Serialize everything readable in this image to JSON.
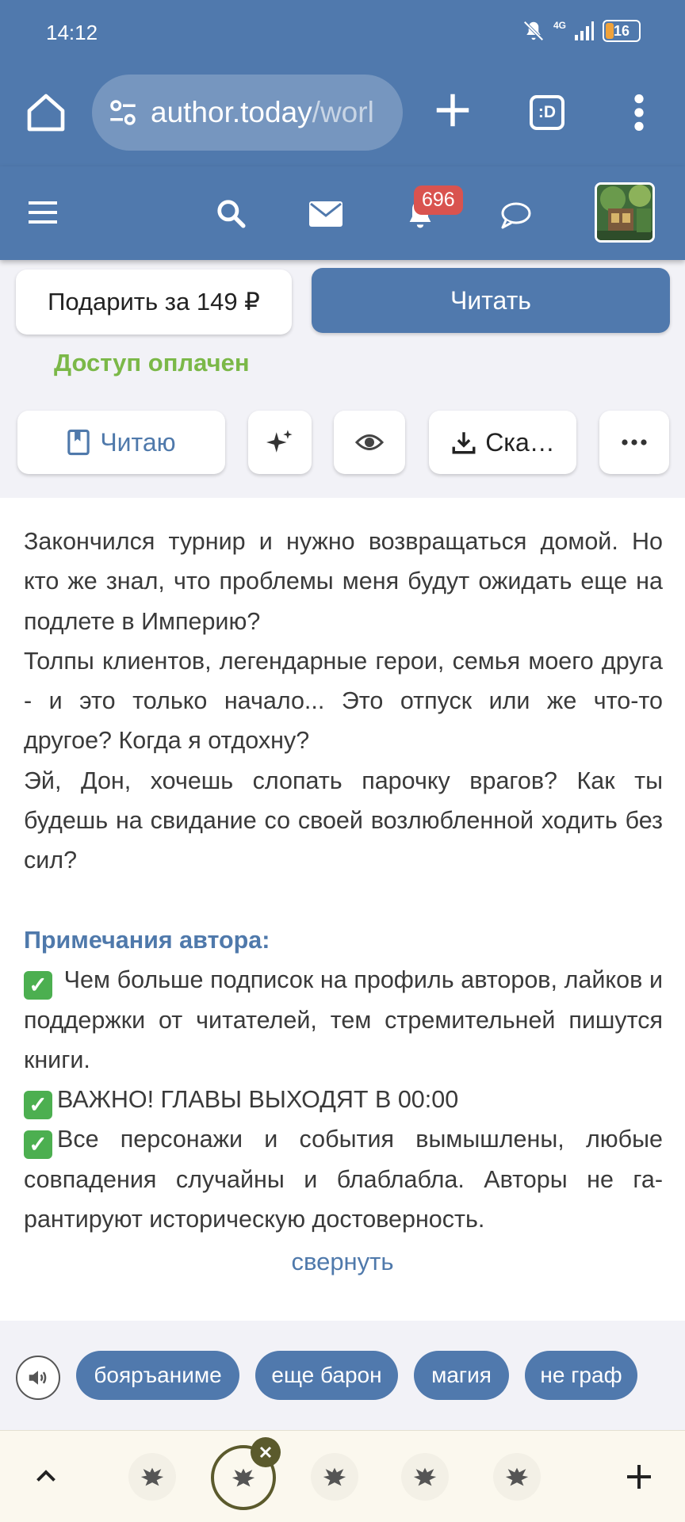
{
  "status_bar": {
    "time": "14:12",
    "network": "4G",
    "battery": "16"
  },
  "browser": {
    "url_main": "author.today",
    "url_rest": "/worl",
    "tabs_label": ":D"
  },
  "header": {
    "notification_count": "696"
  },
  "actions": {
    "gift_label": "Подарить за 149 ₽",
    "read_label": "Читать",
    "access_label": "Доступ оплачен",
    "reading_label": "Читаю",
    "download_label": "Ска…"
  },
  "annotation": {
    "p1": "Закончился турнир и нужно возвращаться домой. Но кто же знал, что проблемы меня будут ожи­дать еще на подлете в Империю?",
    "p2": "Толпы клиентов, легендарные герои, семья моего друга - и это только начало... Это отпуск или же что-то другое? Когда я отдохну?",
    "p3": "Эй, Дон, хочешь слопать парочку врагов? Как ты будешь на свидание со своей возлюбленной хо­дить без сил?",
    "notes_title": "Примечания автора:",
    "n1": " Чем больше подписок на профиль авторов, лайков и поддержки от читателей, тем стреми­тельней пишутся книги.",
    "n2": "ВАЖНО! ГЛАВЫ ВЫХОДЯТ В 00:00",
    "n3": "Все персонажи и события вымышлены, любые совпадения случайны и блаблабла. Авторы не га­рантируют историческую достоверность.",
    "collapse": "свернуть"
  },
  "tags": [
    "бояръаниме",
    "еще барон",
    "магия",
    "не граф"
  ],
  "colors": {
    "brand": "#5079ad",
    "access_green": "#7bb848",
    "badge_red": "#d9534f",
    "check_green": "#4caf50"
  }
}
